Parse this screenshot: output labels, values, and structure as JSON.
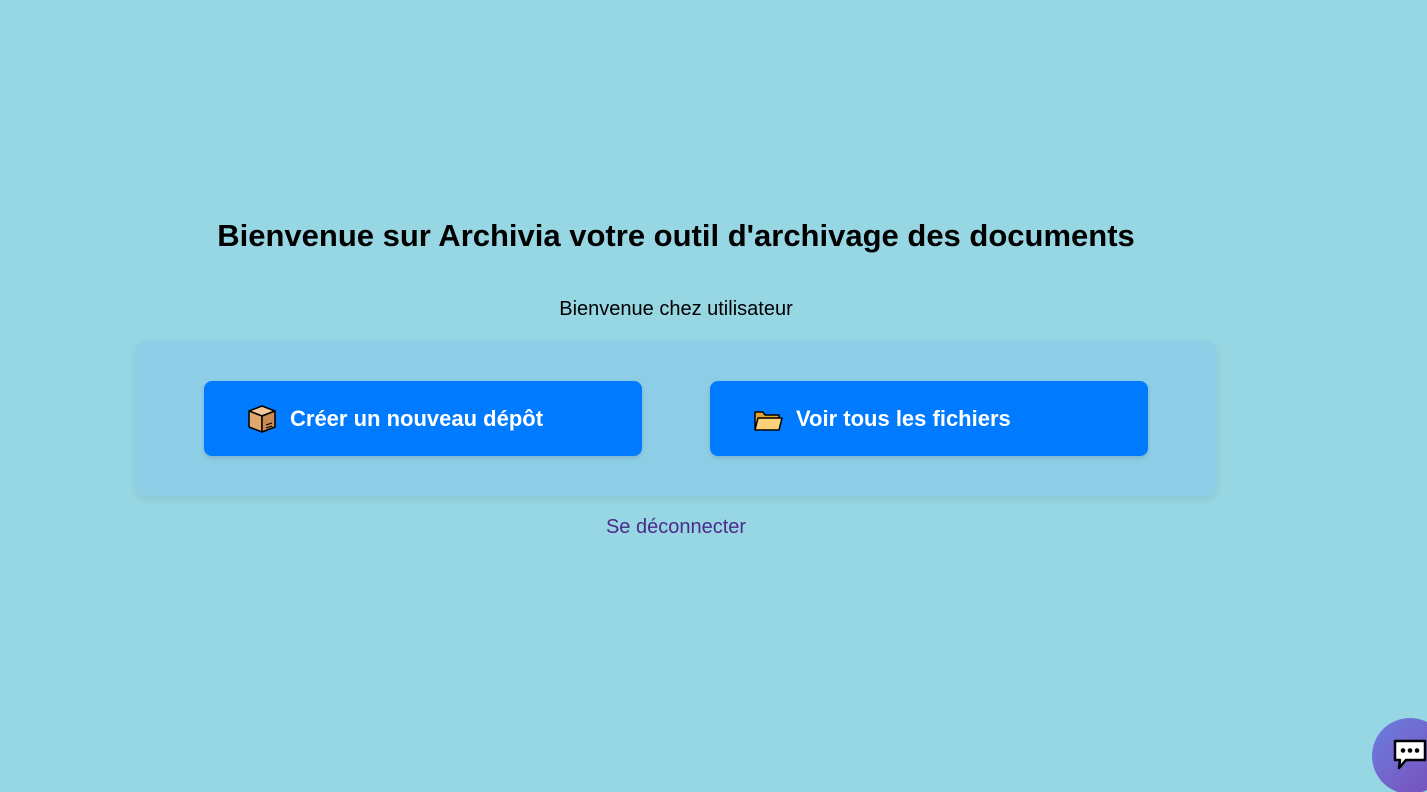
{
  "header": {
    "title": "Bienvenue sur Archivia votre outil d'archivage des documents",
    "welcome": "Bienvenue chez utilisateur"
  },
  "actions": [
    {
      "label": "Créer un nouveau dépôt",
      "icon": "package-icon"
    },
    {
      "label": "Voir tous les fichiers",
      "icon": "folder-icon"
    }
  ],
  "logout": {
    "label": "Se déconnecter"
  },
  "chat": {
    "icon": "chat-bubble-icon"
  },
  "colors": {
    "background": "#97d6e3",
    "card": "#8dcde6",
    "button": "#007bff",
    "link": "#4b2a8a"
  }
}
